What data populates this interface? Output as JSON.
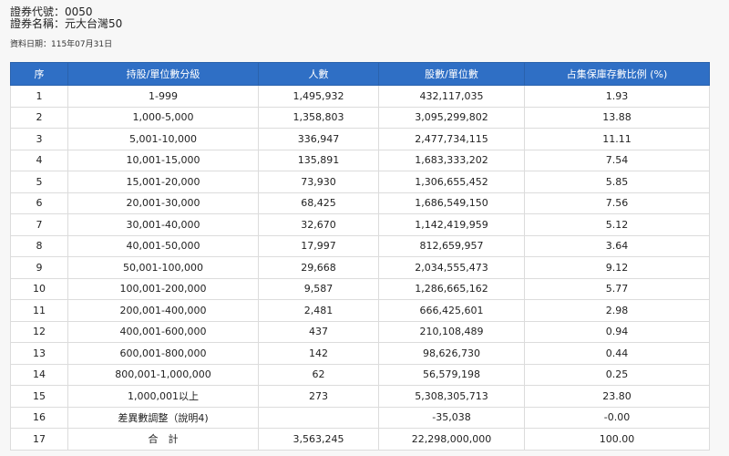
{
  "header": {
    "code_line": "證券代號：0050",
    "name_line": "證券名稱：元大台灣50",
    "date_line": "資料日期：115年07月31日"
  },
  "table": {
    "columns": [
      "序",
      "持股/單位數分級",
      "人數",
      "股數/單位數",
      "占集保庫存數比例 (%)"
    ],
    "rows": [
      [
        "1",
        "1-999",
        "1,495,932",
        "432,117,035",
        "1.93"
      ],
      [
        "2",
        "1,000-5,000",
        "1,358,803",
        "3,095,299,802",
        "13.88"
      ],
      [
        "3",
        "5,001-10,000",
        "336,947",
        "2,477,734,115",
        "11.11"
      ],
      [
        "4",
        "10,001-15,000",
        "135,891",
        "1,683,333,202",
        "7.54"
      ],
      [
        "5",
        "15,001-20,000",
        "73,930",
        "1,306,655,452",
        "5.85"
      ],
      [
        "6",
        "20,001-30,000",
        "68,425",
        "1,686,549,150",
        "7.56"
      ],
      [
        "7",
        "30,001-40,000",
        "32,670",
        "1,142,419,959",
        "5.12"
      ],
      [
        "8",
        "40,001-50,000",
        "17,997",
        "812,659,957",
        "3.64"
      ],
      [
        "9",
        "50,001-100,000",
        "29,668",
        "2,034,555,473",
        "9.12"
      ],
      [
        "10",
        "100,001-200,000",
        "9,587",
        "1,286,665,162",
        "5.77"
      ],
      [
        "11",
        "200,001-400,000",
        "2,481",
        "666,425,601",
        "2.98"
      ],
      [
        "12",
        "400,001-600,000",
        "437",
        "210,108,489",
        "0.94"
      ],
      [
        "13",
        "600,001-800,000",
        "142",
        "98,626,730",
        "0.44"
      ],
      [
        "14",
        "800,001-1,000,000",
        "62",
        "56,579,198",
        "0.25"
      ],
      [
        "15",
        "1,000,001以上",
        "273",
        "5,308,305,713",
        "23.80"
      ],
      [
        "16",
        "差異數調整（說明4)",
        "",
        "-35,038",
        "-0.00"
      ],
      [
        "17",
        "合　計",
        "3,563,245",
        "22,298,000,000",
        "100.00"
      ]
    ]
  },
  "colors": {
    "header_bg": "#2f6fc5",
    "header_text": "#ffffff",
    "border": "#dcdcdc",
    "page_bg": "#f7f7f7"
  }
}
